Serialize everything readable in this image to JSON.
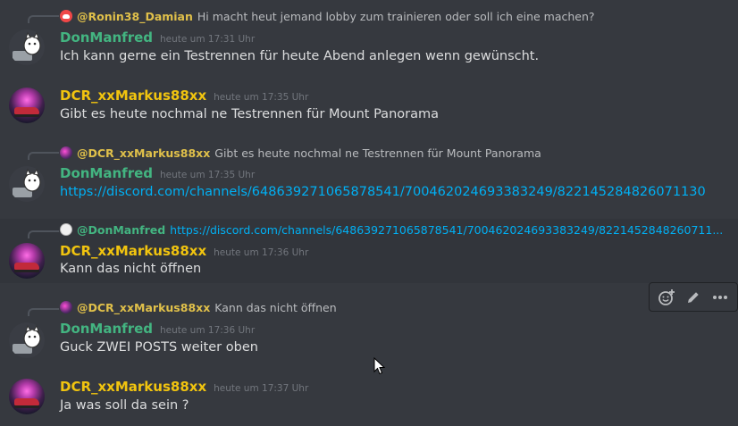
{
  "messages": [
    {
      "reply": {
        "user": "@Ronin38_Damian",
        "text": "Hi macht heut jemand lobby zum trainieren oder soll ich eine machen?"
      },
      "username": "DonManfred",
      "timestamp": "heute um 17:31 Uhr",
      "content": "Ich kann gerne ein Testrennen für heute Abend anlegen wenn gewünscht."
    },
    {
      "username": "DCR_xxMarkus88xx",
      "timestamp": "heute um 17:35 Uhr",
      "content": "Gibt es heute nochmal ne Testrennen für Mount Panorama"
    },
    {
      "reply": {
        "user": "@DCR_xxMarkus88xx",
        "text": "Gibt es heute nochmal ne Testrennen für Mount Panorama"
      },
      "username": "DonManfred",
      "timestamp": "heute um 17:35 Uhr",
      "content": "https://discord.com/channels/648639271065878541/700462024693383249/822145284826071130"
    },
    {
      "reply": {
        "user": "@DonManfred",
        "text": "https://discord.com/channels/648639271065878541/700462024693383249/8221452848260711..."
      },
      "username": "DCR_xxMarkus88xx",
      "timestamp": "heute um 17:36 Uhr",
      "content": "Kann das nicht öffnen"
    },
    {
      "reply": {
        "user": "@DCR_xxMarkus88xx",
        "text": "Kann das nicht öffnen"
      },
      "username": "DonManfred",
      "timestamp": "heute um 17:36 Uhr",
      "content": "Guck ZWEI POSTS weiter oben"
    },
    {
      "username": "DCR_xxMarkus88xx",
      "timestamp": "heute um 17:37 Uhr",
      "content": "Ja was soll da sein ?"
    }
  ],
  "toolbar": {
    "icons": [
      "add-reaction-icon",
      "edit-icon",
      "more-icon"
    ]
  },
  "colors": {
    "background": "#36393f",
    "green_user": "#43b581",
    "yellow_user": "#f1c40f",
    "link": "#00b0f4"
  }
}
